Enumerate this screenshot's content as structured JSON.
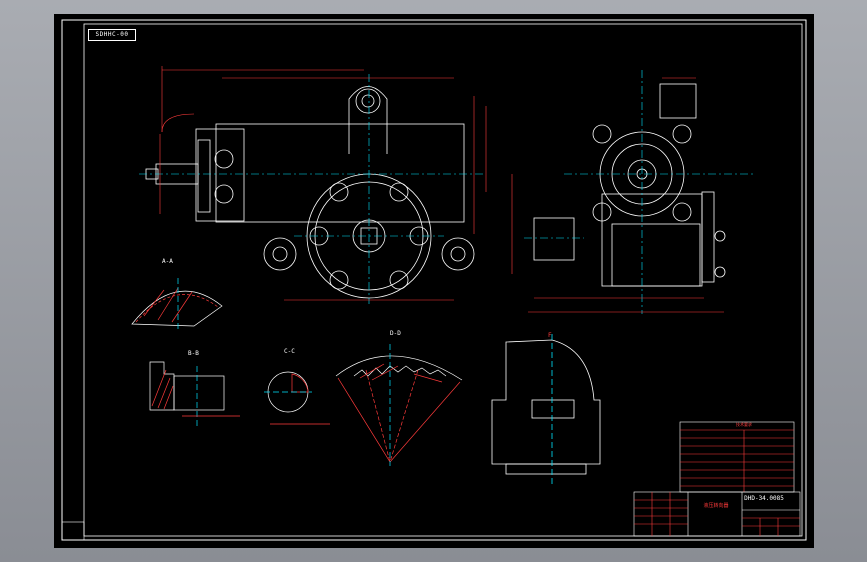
{
  "drawing": {
    "title_tag": "SDHHC-00",
    "drawing_number": "DHD-34.0085",
    "part_name": "液压转向器",
    "tech_table_title": "技术要求",
    "labels": {
      "section_aa": "A-A",
      "section_bb": "B-B",
      "section_cc": "C-C",
      "section_dd": "D-D",
      "view_f": "F"
    }
  },
  "colors": {
    "paper": "#000000",
    "outline": "#ffffff",
    "dimension": "#ff3b3b",
    "centerline": "#00e5ff",
    "label": "#00ff3c",
    "hatch": "#ff3b3b",
    "viewport_border": "#7e8087"
  }
}
